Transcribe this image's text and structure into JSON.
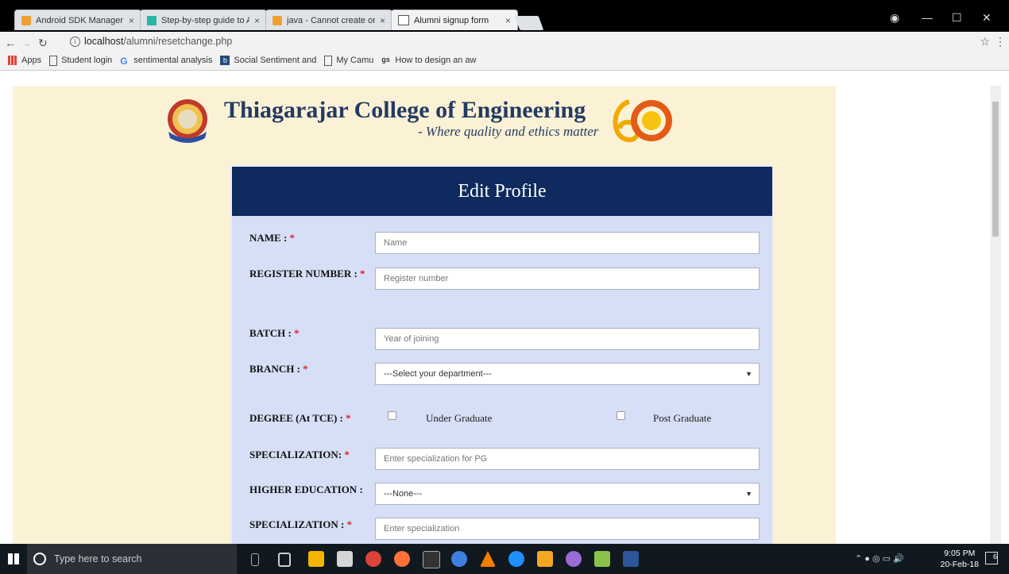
{
  "browser": {
    "tabs": [
      {
        "title": "Android SDK Manager N",
        "icon_color": "#f0a030"
      },
      {
        "title": "Step-by-step guide to Ac",
        "icon_color": "#2bb5a4"
      },
      {
        "title": "java - Cannot create or e",
        "icon_color": "#f0a030"
      },
      {
        "title": "Alumni signup form",
        "icon_color": "#ffffff"
      }
    ],
    "url_host": "localhost",
    "url_path": "/alumni/resetchange.php",
    "bookmarks": [
      {
        "label": "Apps",
        "icon": "apps-grid-icon"
      },
      {
        "label": "Student login",
        "icon": "page-icon"
      },
      {
        "label": "sentimental analysis",
        "icon": "google-icon"
      },
      {
        "label": "Social Sentiment and",
        "icon": "b-icon"
      },
      {
        "label": "My Camu",
        "icon": "page-icon"
      },
      {
        "label": "How to design an aw",
        "icon": "gs-icon"
      }
    ]
  },
  "header": {
    "college": "Thiagarajar College of Engineering",
    "tagline": "- Where quality and ethics matter"
  },
  "form": {
    "title": "Edit Profile",
    "required_mark": "*",
    "name_label": "NAME :",
    "name_placeholder": "Name",
    "register_label": "REGISTER NUMBER :",
    "register_placeholder": "Register number",
    "batch_label": "BATCH :",
    "batch_placeholder": "Year of joining",
    "branch_label": "BRANCH :",
    "branch_selected": "---Select your department---",
    "degree_label": "DEGREE (At TCE) :",
    "degree_options": [
      "Under Graduate",
      "Post Graduate"
    ],
    "specialization_pg_label": "SPECIALIZATION:",
    "specialization_pg_placeholder": "Enter specialization for PG",
    "higher_edu_label": "HIGHER EDUCATION :",
    "higher_edu_selected": "---None---",
    "specialization_label": "SPECIALIZATION :",
    "specialization_placeholder": "Enter specialization"
  },
  "taskbar": {
    "search_placeholder": "Type here to search",
    "time": "9:05 PM",
    "date": "20-Feb-18",
    "notification_count": "6"
  },
  "colors": {
    "page_bg": "#fbf2d6",
    "form_bg": "#d6dff5",
    "form_header": "#0e2a5e",
    "college_text": "#233a62",
    "required": "#e0202a"
  }
}
